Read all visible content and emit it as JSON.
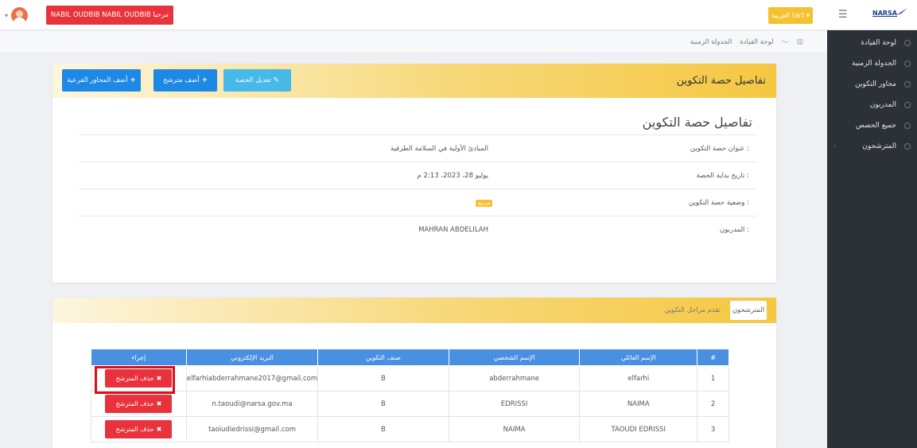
{
  "topbar": {
    "user_label": "NABIL OUDBIB NABIL OUDBIB مرحبا",
    "language_label": "العربية (ar) ▾"
  },
  "sidebar": {
    "logo": "NARSA",
    "items": [
      {
        "label": "لوحة القيادة"
      },
      {
        "label": "الجدولة الزمنية"
      },
      {
        "label": "محاور التكوين"
      },
      {
        "label": "المدربون"
      },
      {
        "label": "جميع الحصص"
      },
      {
        "label": "المترشحون"
      }
    ]
  },
  "breadcrumb": {
    "dashboard": "لوحة القيادة",
    "schedule": "الجدولة الزمنية"
  },
  "card_details": {
    "header_title": "تفاصيل حصة التكوين",
    "buttons": {
      "edit": "تعديل الحصة",
      "add_candidate": "أضف مترشح",
      "add_subtopics": "أضف المحاور الفرعية"
    },
    "section_title": "تفاصيل حصة التكوين",
    "rows": [
      {
        "label": "عنوان حصة التكوين :",
        "value": "المبادئ الأولية في السلامة الطرقية"
      },
      {
        "label": "تاريخ بداية الحصة :",
        "value": "يوليو 28، 2023، 2:13 م"
      },
      {
        "label": "وضعية حصة التكوين :",
        "value": "مبرمج"
      },
      {
        "label": "المدربون :",
        "value": "MAHRAN ABDELILAH"
      }
    ]
  },
  "card_candidates": {
    "tabs": {
      "active": "المترشحون",
      "inactive": "تقدم مراحل التكوين"
    },
    "table": {
      "headers": {
        "index": "#",
        "family_name": "الإسم العائلي",
        "first_name": "الإسم الشخصي",
        "class": "صنف التكوين",
        "email": "البريد الإلكتروني",
        "action": "إجراء"
      },
      "rows": [
        {
          "index": "1",
          "family_name": "elfarhi",
          "first_name": "abderrahmane",
          "class": "B",
          "email": "elfarhiabderrahmane2017@gmail.com",
          "action": "حذف المترشح"
        },
        {
          "index": "2",
          "family_name": "NAIMA",
          "first_name": "EDRISSI",
          "class": "B",
          "email": "n.taoudi@narsa.gov.ma",
          "action": "حذف المترشح"
        },
        {
          "index": "3",
          "family_name": "TAOUDI EDRISSI",
          "first_name": "NAIMA",
          "class": "B",
          "email": "taoiudiedrissi@gmail.com",
          "action": "حذف المترشح"
        }
      ]
    }
  },
  "colors": {
    "sidebar_bg": "#2c3138",
    "header_gold": "#f5c842",
    "primary_blue": "#1e88e5",
    "danger_red": "#e8333c",
    "table_header": "#4a90e2"
  }
}
